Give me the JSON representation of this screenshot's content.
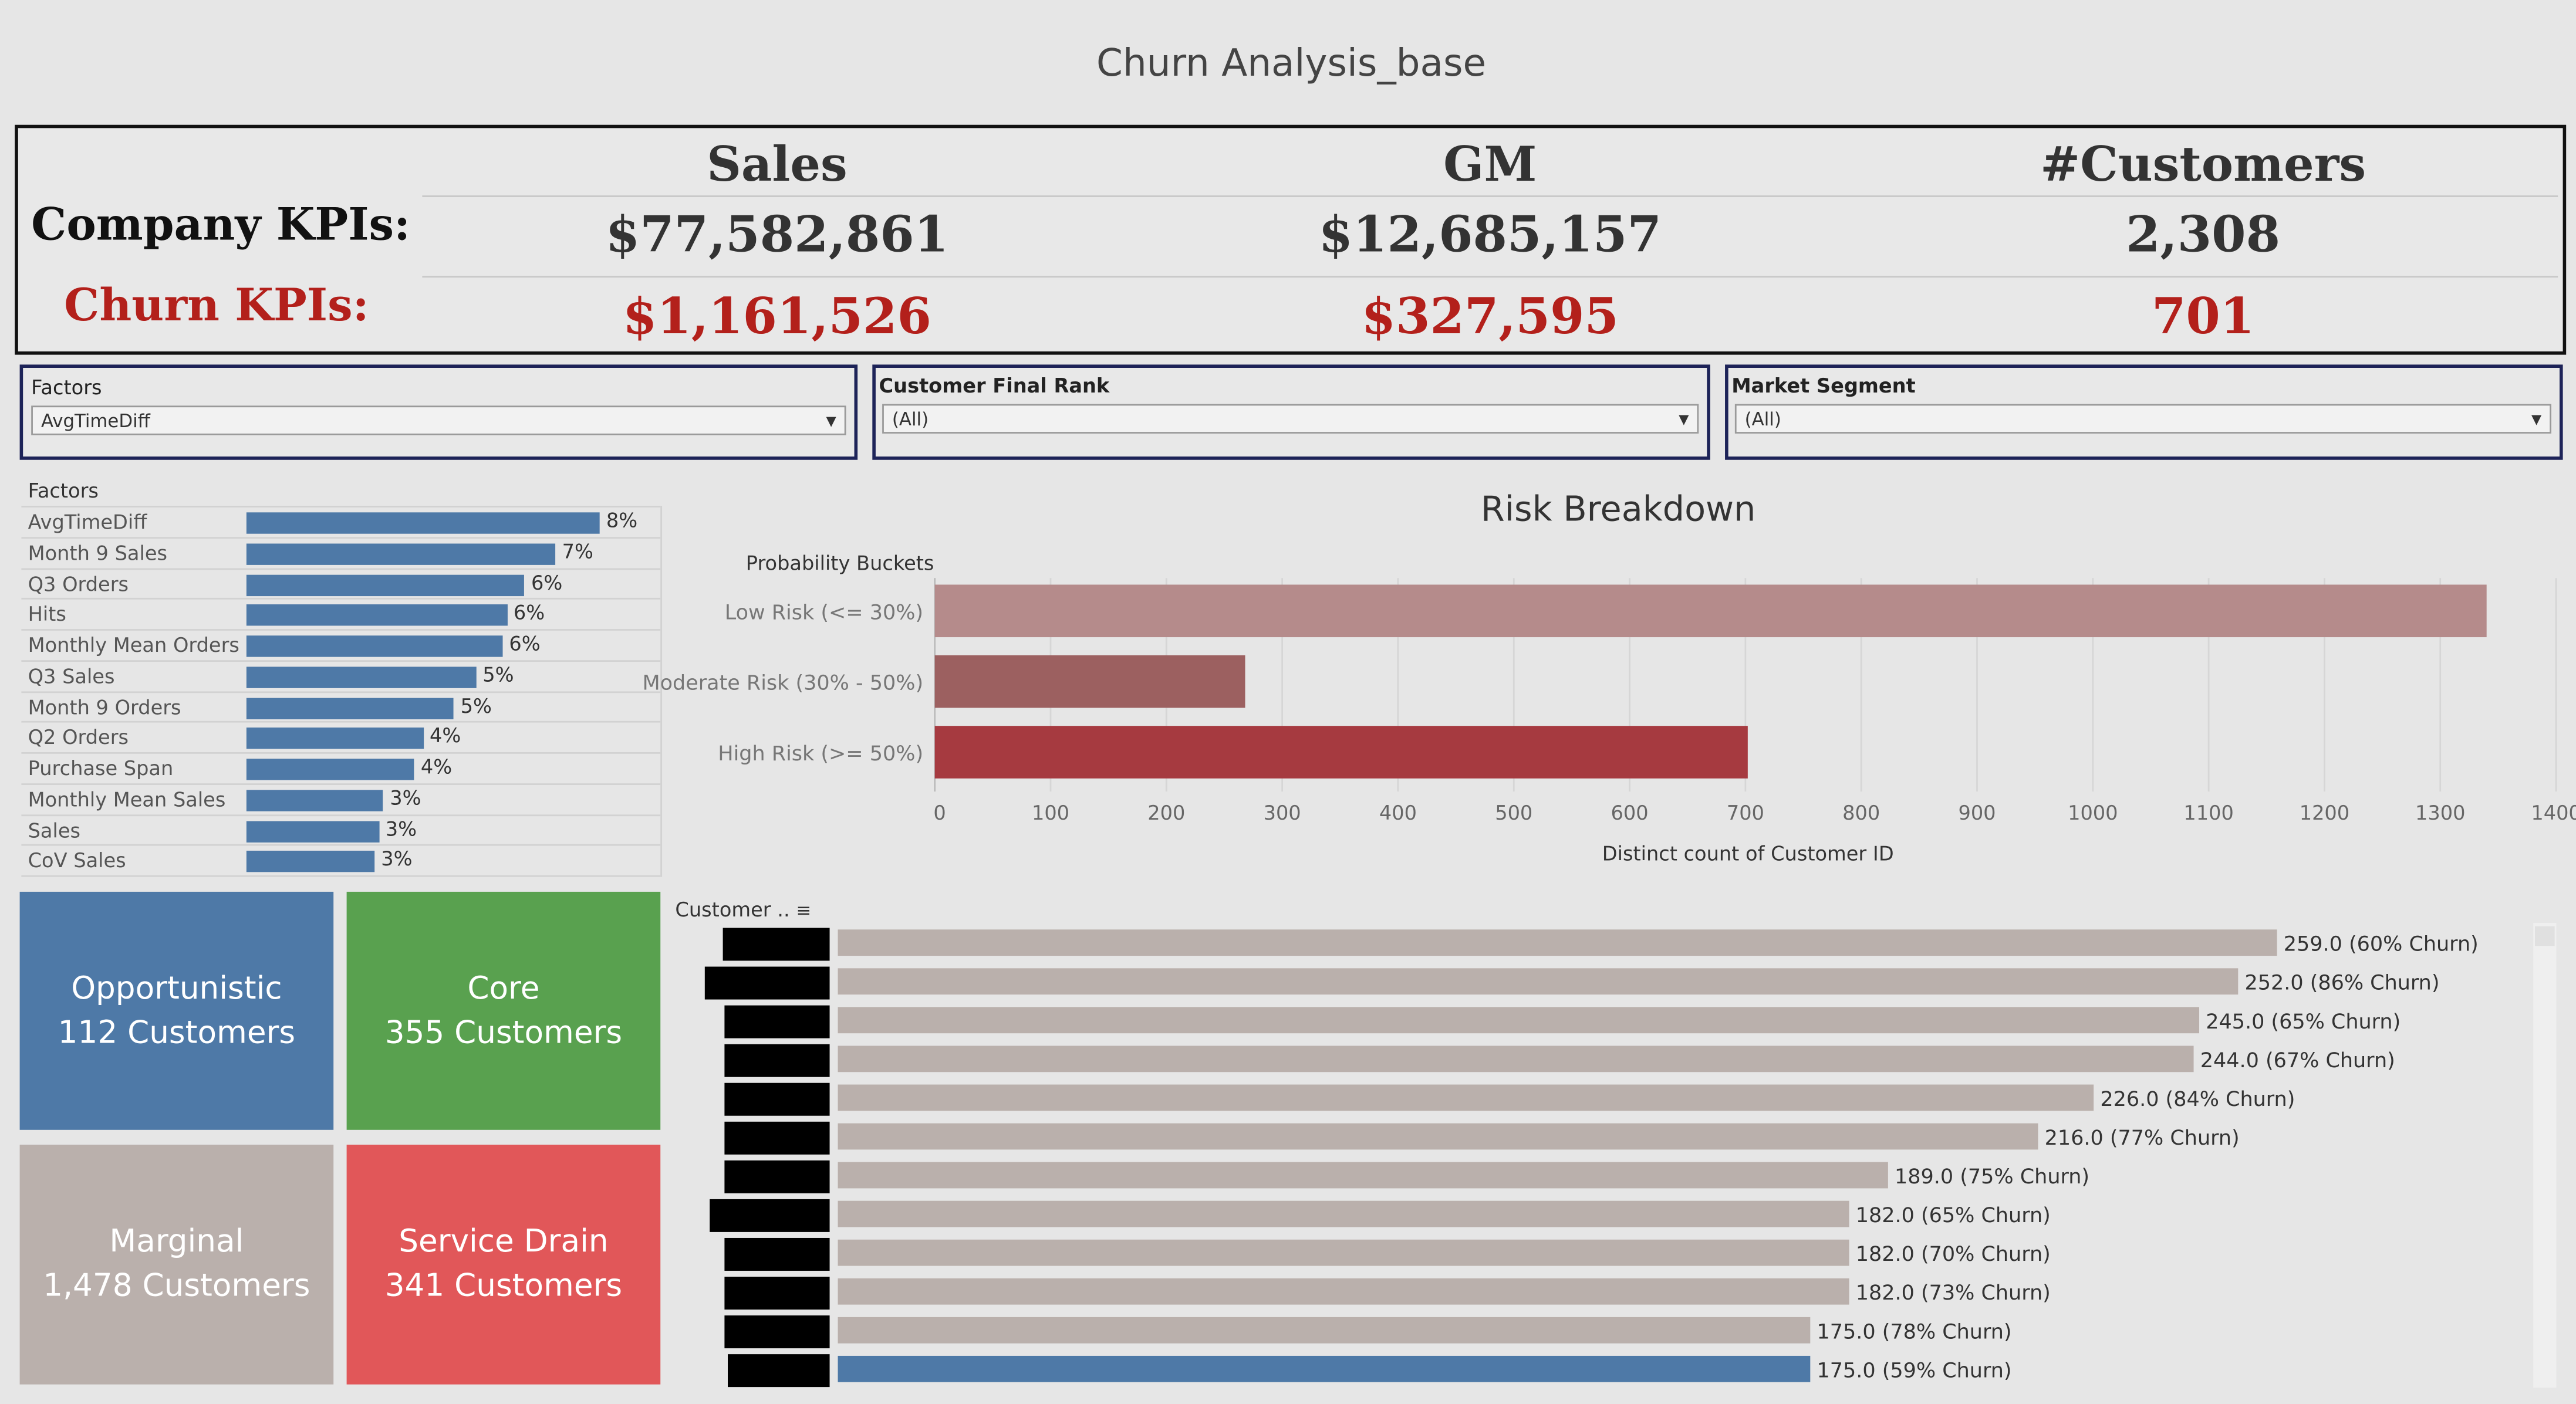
{
  "title": "Churn Analysis_base",
  "kpis": {
    "company_label": "Company KPIs:",
    "churn_label": "Churn KPIs:",
    "columns": [
      {
        "header": "Sales",
        "company": "$77,582,861",
        "churn": "$1,161,526"
      },
      {
        "header": "GM",
        "company": "$12,685,157",
        "churn": "$327,595"
      },
      {
        "header": "#Customers",
        "company": "2,308",
        "churn": "701"
      }
    ]
  },
  "filters": [
    {
      "label": "Factors",
      "value": "AvgTimeDiff"
    },
    {
      "label": "Customer Final Rank",
      "value": "(All)"
    },
    {
      "label": "Market Segment",
      "value": "(All)"
    }
  ],
  "factors": {
    "header": "Factors",
    "items": [
      {
        "name": "AvgTimeDiff",
        "label": "8%",
        "value": 8
      },
      {
        "name": "Month 9 Sales",
        "label": "7%",
        "value": 7
      },
      {
        "name": "Q3 Orders",
        "label": "6%",
        "value": 6.3
      },
      {
        "name": "Hits",
        "label": "6%",
        "value": 5.9
      },
      {
        "name": "Monthly Mean Orders",
        "label": "6%",
        "value": 5.8
      },
      {
        "name": "Q3 Sales",
        "label": "5%",
        "value": 5.2
      },
      {
        "name": "Month 9 Orders",
        "label": "5%",
        "value": 4.7
      },
      {
        "name": "Q2 Orders",
        "label": "4%",
        "value": 4.0
      },
      {
        "name": "Purchase Span",
        "label": "4%",
        "value": 3.8
      },
      {
        "name": "Monthly Mean Sales",
        "label": "3%",
        "value": 3.1
      },
      {
        "name": "Sales",
        "label": "3%",
        "value": 3.0
      },
      {
        "name": "CoV Sales",
        "label": "3%",
        "value": 2.9
      }
    ]
  },
  "chart_data": [
    {
      "type": "bar",
      "title": "Risk Breakdown",
      "ylabel": "Probability Buckets",
      "xlabel": "Distinct count of Customer ID",
      "categories": [
        "Low Risk (<= 30%)",
        "Moderate Risk (30% - 50%)",
        "High Risk (>= 50%)"
      ],
      "values": [
        1340,
        268,
        702
      ],
      "colors": [
        "#b58b8b",
        "#9c6060",
        "#a63a40"
      ],
      "xlim": [
        0,
        1400
      ],
      "ticks": [
        "0",
        "100",
        "200",
        "300",
        "400",
        "500",
        "600",
        "700",
        "800",
        "900",
        "1000",
        "1100",
        "1200",
        "1300",
        "1400"
      ],
      "grid": true
    },
    {
      "type": "bar",
      "column_header": "Customer ..",
      "values": [
        259,
        252,
        245,
        244,
        226,
        216,
        189,
        182,
        182,
        182,
        175,
        175
      ],
      "labels": [
        "259.0 (60% Churn)",
        "252.0 (86% Churn)",
        "245.0 (65% Churn)",
        "244.0 (67% Churn)",
        "226.0 (84% Churn)",
        "216.0 (77% Churn)",
        "189.0 (75% Churn)",
        "182.0 (65% Churn)",
        "182.0 (70% Churn)",
        "182.0 (73% Churn)",
        "175.0 (78% Churn)",
        "175.0 (59% Churn)"
      ],
      "colors": [
        "#bab0ac",
        "#bab0ac",
        "#bab0ac",
        "#bab0ac",
        "#bab0ac",
        "#bab0ac",
        "#bab0ac",
        "#bab0ac",
        "#bab0ac",
        "#bab0ac",
        "#bab0ac",
        "#4e79a7"
      ]
    }
  ],
  "segments": [
    {
      "name": "Opportunistic",
      "count": "112 Customers",
      "color": "#4e79a7"
    },
    {
      "name": "Core",
      "count": "355 Customers",
      "color": "#59a14f"
    },
    {
      "name": "Marginal",
      "count": "1,478 Customers",
      "color": "#bab0ac"
    },
    {
      "name": "Service Drain",
      "count": "341 Customers",
      "color": "#e15759"
    }
  ]
}
